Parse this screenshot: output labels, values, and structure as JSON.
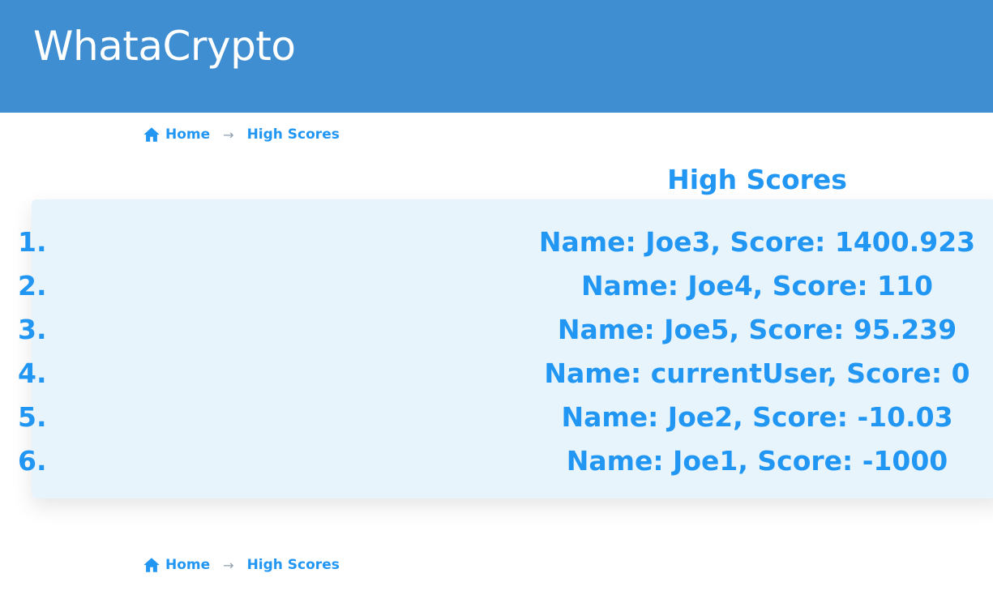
{
  "header": {
    "brand": "WhataCrypto"
  },
  "breadcrumb": {
    "home_label": "Home",
    "separator": "→",
    "current_label": "High Scores"
  },
  "page": {
    "title": "High Scores"
  },
  "scores": [
    {
      "rank": "1.",
      "text": "Name: Joe3, Score: 1400.923"
    },
    {
      "rank": "2.",
      "text": "Name: Joe4, Score: 110"
    },
    {
      "rank": "3.",
      "text": "Name: Joe5, Score: 95.239"
    },
    {
      "rank": "4.",
      "text": "Name: currentUser, Score: 0"
    },
    {
      "rank": "5.",
      "text": "Name: Joe2, Score: -10.03"
    },
    {
      "rank": "6.",
      "text": "Name: Joe1, Score: -1000"
    }
  ],
  "colors": {
    "header_bg": "#3f8ed2",
    "accent": "#2196f3",
    "panel_bg": "#e8f4fc"
  },
  "icons": {
    "home": "home-icon"
  }
}
